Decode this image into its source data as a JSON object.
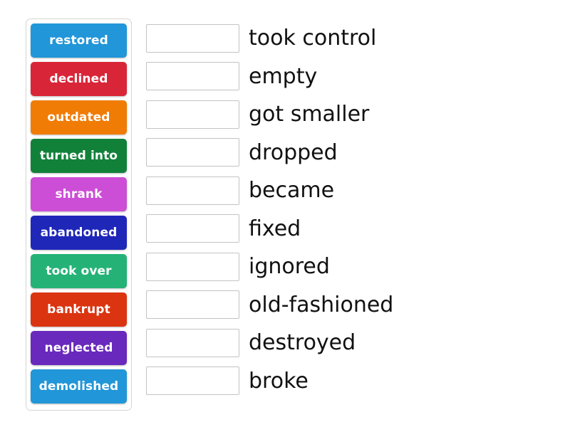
{
  "activity": {
    "type": "match-up",
    "tray": {
      "tiles": [
        {
          "label": "restored",
          "color": "#2196d8"
        },
        {
          "label": "declined",
          "color": "#d92538"
        },
        {
          "label": "outdated",
          "color": "#f07c06"
        },
        {
          "label": "turned into",
          "color": "#11813a"
        },
        {
          "label": "shrank",
          "color": "#cc4ed6"
        },
        {
          "label": "abandoned",
          "color": "#1f27b8"
        },
        {
          "label": "took over",
          "color": "#25b277"
        },
        {
          "label": "bankrupt",
          "color": "#db3410"
        },
        {
          "label": "neglected",
          "color": "#6a29bd"
        },
        {
          "label": "demolished",
          "color": "#2196d8"
        }
      ]
    },
    "matches": [
      {
        "drop_value": "",
        "definition": "took control"
      },
      {
        "drop_value": "",
        "definition": "empty"
      },
      {
        "drop_value": "",
        "definition": "got smaller"
      },
      {
        "drop_value": "",
        "definition": "dropped"
      },
      {
        "drop_value": "",
        "definition": "became"
      },
      {
        "drop_value": "",
        "definition": "fixed"
      },
      {
        "drop_value": "",
        "definition": "ignored"
      },
      {
        "drop_value": "",
        "definition": "old-fashioned"
      },
      {
        "drop_value": "",
        "definition": "destroyed"
      },
      {
        "drop_value": "",
        "definition": "broke"
      }
    ]
  }
}
